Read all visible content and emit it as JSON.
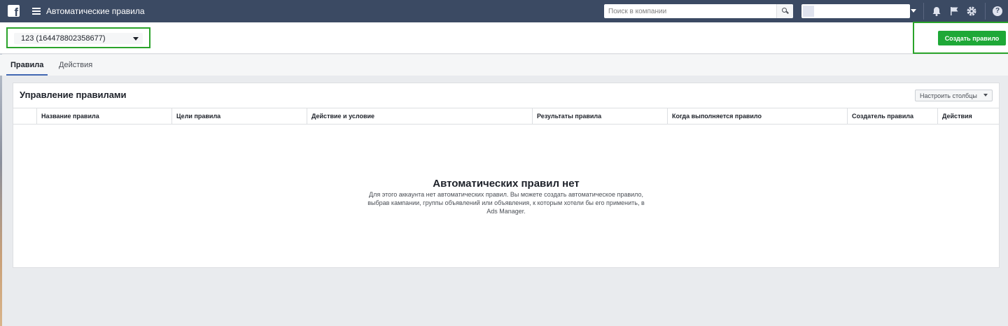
{
  "topbar": {
    "app_title": "Автоматические правила",
    "search_placeholder": "Поиск в компании",
    "logo_glyph": "f",
    "icons": [
      "facebook-logo",
      "menu-icon",
      "search-icon",
      "bell-icon",
      "flag-icon",
      "gear-icon",
      "help-icon"
    ],
    "help_glyph": "?"
  },
  "actionbar": {
    "account_label": "123 (164478802358677)",
    "create_rule_label": "Создать правило"
  },
  "tabs": [
    {
      "label": "Правила",
      "active": true
    },
    {
      "label": "Действия",
      "active": false
    }
  ],
  "panel": {
    "title": "Управление правилами",
    "columns_button": "Настроить столбцы",
    "columns": [
      "Название правила",
      "Цели правила",
      "Действие и условие",
      "Результаты правила",
      "Когда выполняется правило",
      "Создатель правила",
      "Действия"
    ],
    "empty_title": "Автоматических правил нет",
    "empty_description": "Для этого аккаунта нет автоматических правил. Вы можете создать автоматическое правило, выбрав кампании, группы объявлений или объявления, к которым хотели бы его применить, в Ads Manager."
  },
  "colors": {
    "topbar_bg": "#3b4a63",
    "accent_green": "#1ea837",
    "highlight_frame": "#2aa32a",
    "tab_underline": "#4267b2"
  }
}
